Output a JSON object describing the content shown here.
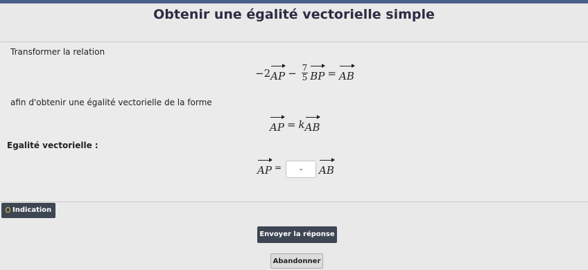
{
  "header": {
    "title": "Obtenir une égalité vectorielle simple"
  },
  "exercise": {
    "instruction_1": "Transformer la relation",
    "relation": {
      "coef1": "−2",
      "vec1": "AP",
      "minus": "−",
      "frac_num": "7",
      "frac_den": "5",
      "vec2": "BP",
      "equals": "=",
      "vec3": "AB"
    },
    "instruction_2": "afin d'obtenir une égalité vectorielle de la forme",
    "target_form": {
      "vec_left": "AP",
      "equals": "=",
      "k": "k",
      "vec_right": "AB"
    },
    "answer_label": "Egalité vectorielle :",
    "answer": {
      "vec_left": "AP",
      "equals": "=",
      "dropdown_value": "",
      "dropdown_chevron": "⌄",
      "vec_right": "AB"
    }
  },
  "buttons": {
    "hint_label": "Indication",
    "submit_label": "Envoyer la réponse",
    "abandon_label": "Abandonner"
  }
}
